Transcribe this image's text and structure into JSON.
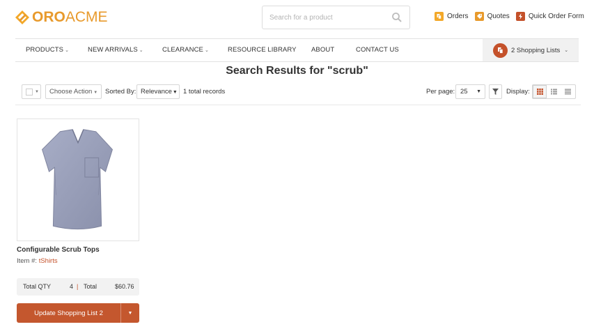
{
  "header": {
    "logo": {
      "part1": "ORO",
      "part2": "ACME"
    },
    "search": {
      "placeholder": "Search for a product",
      "icon": "search-icon"
    },
    "links": [
      {
        "label": "Orders",
        "icon": "orders-icon",
        "color": "#f3a829"
      },
      {
        "label": "Quotes",
        "icon": "quotes-icon",
        "color": "#e89a2c"
      },
      {
        "label": "Quick Order Form",
        "icon": "lightning-icon",
        "color": "#c4512a"
      }
    ]
  },
  "nav": {
    "items": [
      {
        "label": "PRODUCTS",
        "has_dropdown": true
      },
      {
        "label": "NEW ARRIVALS",
        "has_dropdown": true
      },
      {
        "label": "CLEARANCE",
        "has_dropdown": true
      },
      {
        "label": "RESOURCE LIBRARY",
        "has_dropdown": false
      },
      {
        "label": "ABOUT",
        "has_dropdown": false
      },
      {
        "label": "CONTACT US",
        "has_dropdown": false
      }
    ],
    "shopping_lists": {
      "label": "2 Shopping Lists",
      "icon": "shopping-list-icon"
    }
  },
  "page": {
    "title": "Search Results for \"scrub\""
  },
  "toolbar": {
    "choose_action": "Choose Action",
    "sorted_by_label": "Sorted By:",
    "sort_value": "Relevance",
    "total_records": "1 total records",
    "per_page_label": "Per page:",
    "per_page_value": "25",
    "display_label": "Display:",
    "view_modes": [
      "grid",
      "list",
      "compact"
    ],
    "active_view": "grid"
  },
  "products": [
    {
      "name": "Configurable Scrub Tops",
      "item_label": "Item #:",
      "sku": "tShirts",
      "total_qty_label": "Total QTY",
      "total_qty": "4",
      "sep": "|",
      "total_label": "Total",
      "total_price": "$60.76",
      "button_label": "Update Shopping List 2"
    }
  ],
  "colors": {
    "brand": "#e89a2c",
    "accent": "#c4512a"
  }
}
